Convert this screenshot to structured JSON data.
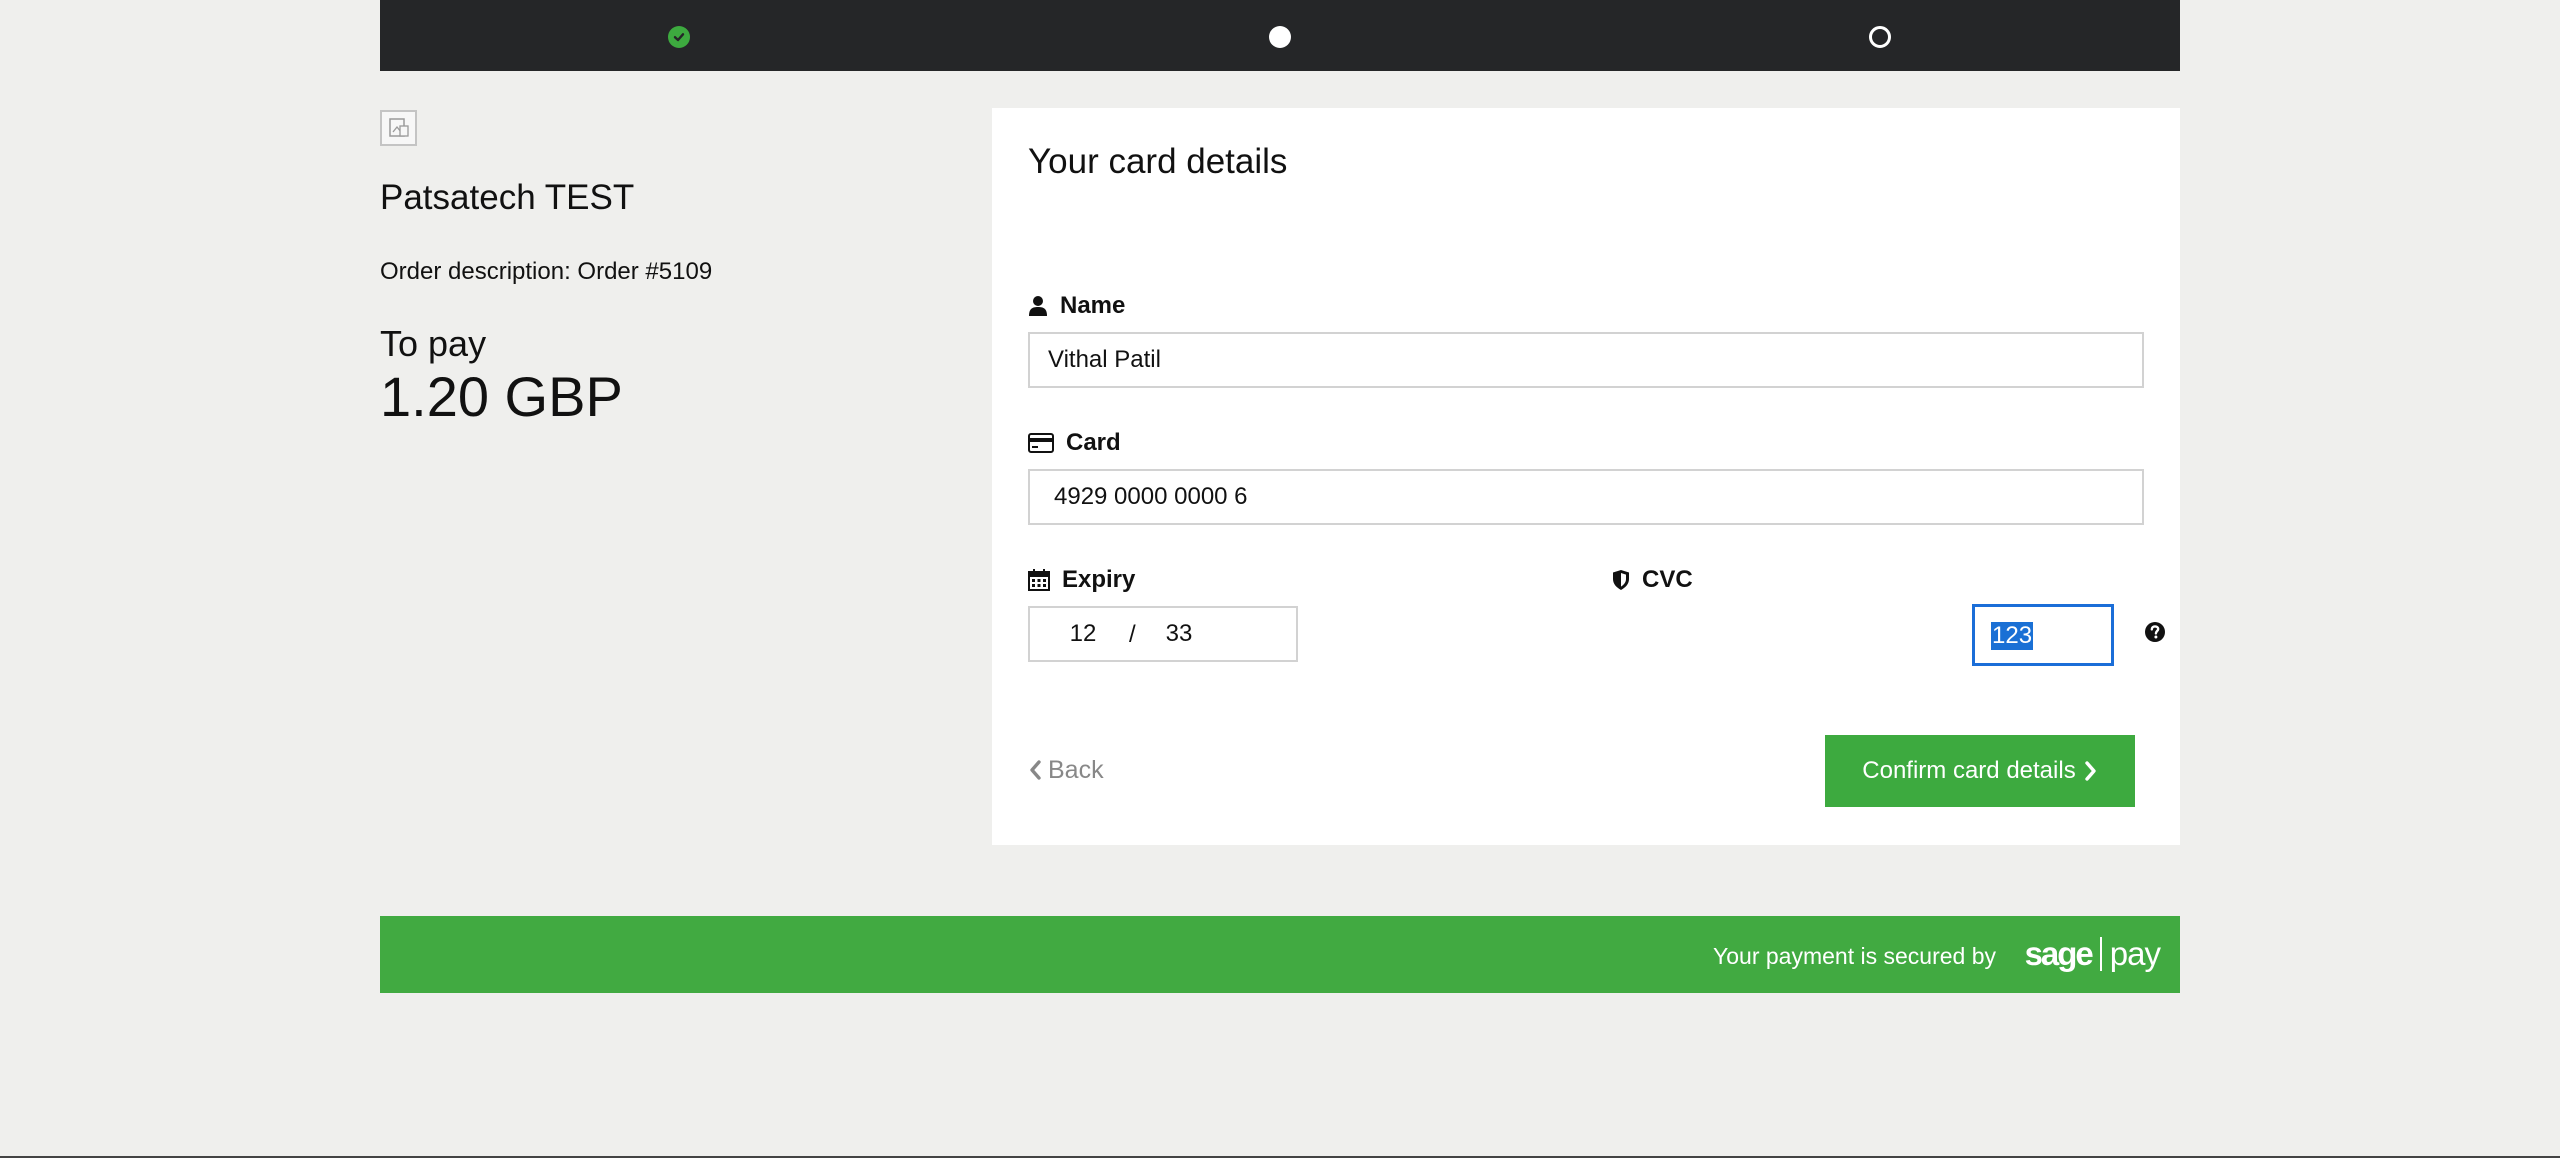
{
  "progress": {
    "steps": [
      {
        "state": "completed",
        "icon": "check-icon"
      },
      {
        "state": "current",
        "icon": "filled-dot-icon"
      },
      {
        "state": "upcoming",
        "icon": "hollow-dot-icon"
      }
    ]
  },
  "merchant": {
    "name": "Patsatech TEST",
    "order_description": "Order description: Order #5109",
    "to_pay_label": "To pay",
    "amount": "1.20 GBP"
  },
  "form": {
    "title": "Your card details",
    "name": {
      "label": "Name",
      "icon": "user-icon",
      "value": "Vithal Patil"
    },
    "card": {
      "label": "Card",
      "icon": "credit-card-icon",
      "value": "4929 0000 0000 6"
    },
    "expiry": {
      "label": "Expiry",
      "icon": "calendar-icon",
      "month": "12",
      "separator": "/",
      "year": "33"
    },
    "cvc": {
      "label": "CVC",
      "icon": "shield-icon",
      "value": "123",
      "help_icon": "question-circle-icon"
    },
    "back_label": "Back",
    "confirm_label": "Confirm card details"
  },
  "footer": {
    "secured_text": "Your payment is secured by",
    "logo_sage": "sage",
    "logo_pay": "pay"
  },
  "colors": {
    "progress_bg": "#252628",
    "accent_green": "#3daa3f",
    "focus_blue": "#1b6ed8",
    "page_bg": "#efefed"
  }
}
